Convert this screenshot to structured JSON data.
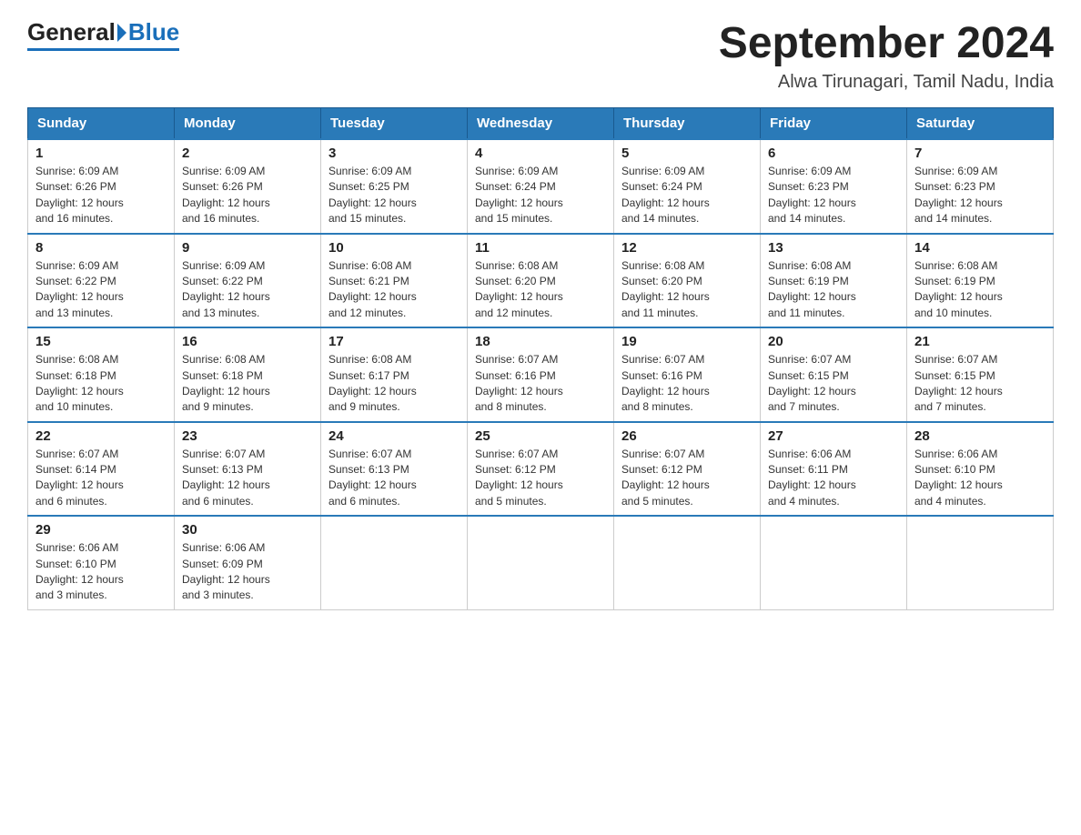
{
  "logo": {
    "general": "General",
    "blue": "Blue"
  },
  "title": "September 2024",
  "subtitle": "Alwa Tirunagari, Tamil Nadu, India",
  "weekdays": [
    "Sunday",
    "Monday",
    "Tuesday",
    "Wednesday",
    "Thursday",
    "Friday",
    "Saturday"
  ],
  "weeks": [
    [
      {
        "day": "1",
        "sunrise": "6:09 AM",
        "sunset": "6:26 PM",
        "daylight": "12 hours and 16 minutes."
      },
      {
        "day": "2",
        "sunrise": "6:09 AM",
        "sunset": "6:26 PM",
        "daylight": "12 hours and 16 minutes."
      },
      {
        "day": "3",
        "sunrise": "6:09 AM",
        "sunset": "6:25 PM",
        "daylight": "12 hours and 15 minutes."
      },
      {
        "day": "4",
        "sunrise": "6:09 AM",
        "sunset": "6:24 PM",
        "daylight": "12 hours and 15 minutes."
      },
      {
        "day": "5",
        "sunrise": "6:09 AM",
        "sunset": "6:24 PM",
        "daylight": "12 hours and 14 minutes."
      },
      {
        "day": "6",
        "sunrise": "6:09 AM",
        "sunset": "6:23 PM",
        "daylight": "12 hours and 14 minutes."
      },
      {
        "day": "7",
        "sunrise": "6:09 AM",
        "sunset": "6:23 PM",
        "daylight": "12 hours and 14 minutes."
      }
    ],
    [
      {
        "day": "8",
        "sunrise": "6:09 AM",
        "sunset": "6:22 PM",
        "daylight": "12 hours and 13 minutes."
      },
      {
        "day": "9",
        "sunrise": "6:09 AM",
        "sunset": "6:22 PM",
        "daylight": "12 hours and 13 minutes."
      },
      {
        "day": "10",
        "sunrise": "6:08 AM",
        "sunset": "6:21 PM",
        "daylight": "12 hours and 12 minutes."
      },
      {
        "day": "11",
        "sunrise": "6:08 AM",
        "sunset": "6:20 PM",
        "daylight": "12 hours and 12 minutes."
      },
      {
        "day": "12",
        "sunrise": "6:08 AM",
        "sunset": "6:20 PM",
        "daylight": "12 hours and 11 minutes."
      },
      {
        "day": "13",
        "sunrise": "6:08 AM",
        "sunset": "6:19 PM",
        "daylight": "12 hours and 11 minutes."
      },
      {
        "day": "14",
        "sunrise": "6:08 AM",
        "sunset": "6:19 PM",
        "daylight": "12 hours and 10 minutes."
      }
    ],
    [
      {
        "day": "15",
        "sunrise": "6:08 AM",
        "sunset": "6:18 PM",
        "daylight": "12 hours and 10 minutes."
      },
      {
        "day": "16",
        "sunrise": "6:08 AM",
        "sunset": "6:18 PM",
        "daylight": "12 hours and 9 minutes."
      },
      {
        "day": "17",
        "sunrise": "6:08 AM",
        "sunset": "6:17 PM",
        "daylight": "12 hours and 9 minutes."
      },
      {
        "day": "18",
        "sunrise": "6:07 AM",
        "sunset": "6:16 PM",
        "daylight": "12 hours and 8 minutes."
      },
      {
        "day": "19",
        "sunrise": "6:07 AM",
        "sunset": "6:16 PM",
        "daylight": "12 hours and 8 minutes."
      },
      {
        "day": "20",
        "sunrise": "6:07 AM",
        "sunset": "6:15 PM",
        "daylight": "12 hours and 7 minutes."
      },
      {
        "day": "21",
        "sunrise": "6:07 AM",
        "sunset": "6:15 PM",
        "daylight": "12 hours and 7 minutes."
      }
    ],
    [
      {
        "day": "22",
        "sunrise": "6:07 AM",
        "sunset": "6:14 PM",
        "daylight": "12 hours and 6 minutes."
      },
      {
        "day": "23",
        "sunrise": "6:07 AM",
        "sunset": "6:13 PM",
        "daylight": "12 hours and 6 minutes."
      },
      {
        "day": "24",
        "sunrise": "6:07 AM",
        "sunset": "6:13 PM",
        "daylight": "12 hours and 6 minutes."
      },
      {
        "day": "25",
        "sunrise": "6:07 AM",
        "sunset": "6:12 PM",
        "daylight": "12 hours and 5 minutes."
      },
      {
        "day": "26",
        "sunrise": "6:07 AM",
        "sunset": "6:12 PM",
        "daylight": "12 hours and 5 minutes."
      },
      {
        "day": "27",
        "sunrise": "6:06 AM",
        "sunset": "6:11 PM",
        "daylight": "12 hours and 4 minutes."
      },
      {
        "day": "28",
        "sunrise": "6:06 AM",
        "sunset": "6:10 PM",
        "daylight": "12 hours and 4 minutes."
      }
    ],
    [
      {
        "day": "29",
        "sunrise": "6:06 AM",
        "sunset": "6:10 PM",
        "daylight": "12 hours and 3 minutes."
      },
      {
        "day": "30",
        "sunrise": "6:06 AM",
        "sunset": "6:09 PM",
        "daylight": "12 hours and 3 minutes."
      },
      null,
      null,
      null,
      null,
      null
    ]
  ],
  "labels": {
    "sunrise": "Sunrise:",
    "sunset": "Sunset:",
    "daylight": "Daylight:"
  }
}
